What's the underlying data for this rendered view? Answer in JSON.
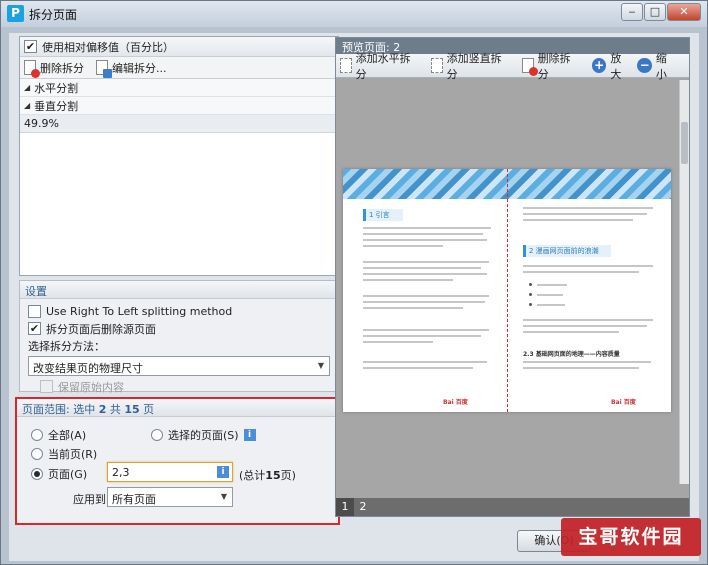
{
  "window": {
    "title": "拆分页面",
    "app_icon_letter": "P",
    "controls": {
      "minimize": "‒",
      "maximize": "□",
      "close": "✕"
    }
  },
  "left_panel": {
    "use_offset_label": "使用相对偏移值（百分比）",
    "use_offset_checked": true,
    "toolbar": {
      "delete_split": "删除拆分",
      "edit_split": "编辑拆分..."
    },
    "tree": [
      {
        "label": "水平分割"
      },
      {
        "label": "垂直分割"
      }
    ],
    "value": "49.9%"
  },
  "settings": {
    "header": "设置",
    "rtl_label": "Use Right To Left splitting method",
    "rtl_checked": false,
    "delete_source_label": "拆分页面后删除源页面",
    "delete_source_checked": true,
    "method_label": "选择拆分方法：",
    "method_value": "改变结果页的物理尺寸",
    "keep_content_label": "保留原始内容",
    "keep_content_checked": false
  },
  "page_range": {
    "header_prefix": "页面范围: 选中 ",
    "selected": "2",
    "header_mid": " 共 ",
    "total": "15",
    "header_suffix": " 页",
    "all_label": "全部(A)",
    "selected_pages_label": "选择的页面(S)",
    "current_label": "当前页(R)",
    "pages_label": "页面(G)",
    "pages_value": "2,3",
    "total_prefix": "(总计 ",
    "total_count": "15",
    "total_suffix": " 页)",
    "apply_label": "应用到:",
    "apply_value": "所有页面",
    "active_option": "pages"
  },
  "preview": {
    "header": "预览页面: 2",
    "toolbar": {
      "add_horizontal": "添加水平拆分",
      "add_vertical": "添加竖直拆分",
      "delete_split": "删除拆分",
      "zoom_in": "放大",
      "zoom_out": "缩小"
    },
    "page_tabs": [
      "1",
      "2"
    ],
    "active_tab": "1",
    "doc": {
      "left_heading": "1 引言",
      "right_heading": "2 漫画网页面前的浪潮",
      "right_subheading": "2.3 基础网页面的地理——内容质量",
      "footer_logo": "Bai 百度"
    }
  },
  "buttons": {
    "ok": "确认(O)"
  },
  "watermark": "宝哥软件园",
  "colors": {
    "highlight_border": "#d9272e",
    "accent": "#3b78c4",
    "split_line": "#d42c2c"
  }
}
